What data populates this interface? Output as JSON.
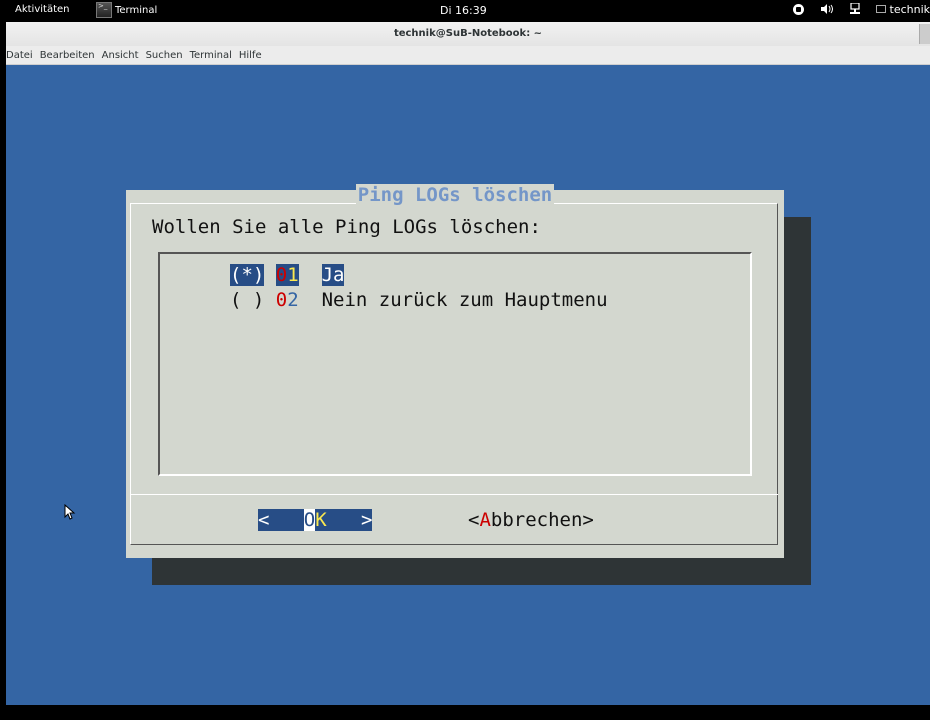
{
  "topbar": {
    "activities": "Aktivitäten",
    "app_name": "Terminal",
    "clock": "Di 16:39",
    "user": "technik"
  },
  "window": {
    "title": "technik@SuB-Notebook: ~",
    "menu": [
      "Datei",
      "Bearbeiten",
      "Ansicht",
      "Suchen",
      "Terminal",
      "Hilfe"
    ]
  },
  "dialog": {
    "title": "Ping LOGs löschen",
    "question": "Wollen Sie alle Ping LOGs löschen:",
    "items": [
      {
        "marker": "(*)",
        "tag_first": "0",
        "tag_second": "1",
        "label": "Ja",
        "selected": true
      },
      {
        "marker": "( )",
        "tag_first": "0",
        "tag_second": "2",
        "label": "Nein zurück zum Hauptmenu",
        "selected": false
      }
    ],
    "ok_button": {
      "left": "<",
      "first": "O",
      "second": "K",
      "right": ">"
    },
    "cancel_button": {
      "open": "<",
      "hotkey": "A",
      "rest": "bbrechen",
      "close": ">"
    }
  },
  "colors": {
    "terminal_bg": "#3465a4",
    "dialog_bg": "#d3d7cf",
    "highlight": "#274d86",
    "title": "#7496c8",
    "hotkey_red": "#cc0000",
    "hotkey_yellow": "#fce94f"
  },
  "icons": [
    "terminal-icon",
    "accessibility-icon",
    "volume-icon",
    "network-icon",
    "user-icon",
    "mouse-cursor-icon"
  ]
}
